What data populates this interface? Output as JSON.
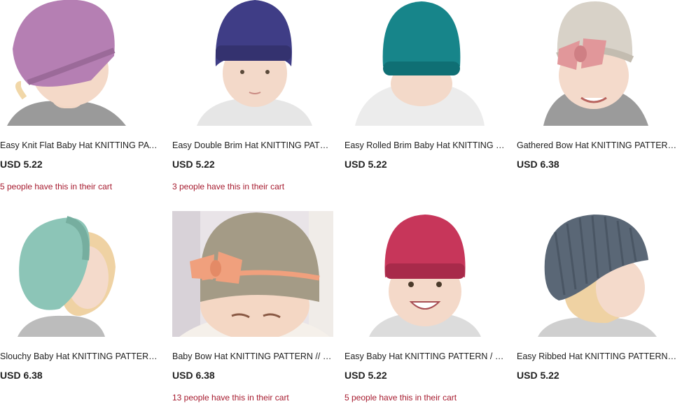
{
  "listings": [
    {
      "title": "Easy Knit Flat Baby Hat KNITTING PATTERN / Knit Baby Hat Pattern",
      "price": "USD 5.22",
      "cart_note": "5 people have this in their cart",
      "hat_color": "#b57fb3",
      "bg": "#ffffff",
      "hair": "#f1d7a8",
      "shirt": "#9a9a9a"
    },
    {
      "title": "Easy Double Brim Hat KNITTING PATTERN / Baby Hat Pattern",
      "price": "USD 5.22",
      "cart_note": "3 people have this in their cart",
      "hat_color": "#3f3d86",
      "bg": "#ffffff",
      "hair": "#d9b48c",
      "shirt": "#e6e6e6"
    },
    {
      "title": "Easy Rolled Brim Baby Hat KNITTING PATTERN / Knit Hat",
      "price": "USD 5.22",
      "cart_note": "",
      "hat_color": "#17858a",
      "bg": "#ffffff",
      "hair": "#e9c6a0",
      "shirt": "#ececec"
    },
    {
      "title": "Gathered Bow Hat KNITTING PATTERN / Baby Hat with Bow",
      "price": "USD 6.38",
      "cart_note": "",
      "hat_color": "#d8d2c8",
      "bg": "#ffffff",
      "hair": "#e6c49b",
      "shirt": "#9b9b9b",
      "bow": "#e1979a"
    },
    {
      "title": "Slouchy Baby Hat KNITTING PATTERN / Knit Slouch Hat",
      "price": "USD 6.38",
      "cart_note": "",
      "hat_color": "#8cc5b7",
      "bg": "#ffffff",
      "hair": "#efd2a3",
      "shirt": "#bcbcbc"
    },
    {
      "title": "Baby Bow Hat KNITTING PATTERN // Knit Hat with Bow",
      "price": "USD 6.38",
      "cart_note": "13 people have this in their cart",
      "hat_color": "#a49b86",
      "bg": "#e9e4e8",
      "hair": "#e9c6a0",
      "shirt": "#f5f0ea",
      "bow": "#f0a07d"
    },
    {
      "title": "Easy Baby Hat KNITTING PATTERN / Easy Knit Hat",
      "price": "USD 5.22",
      "cart_note": "5 people have this in their cart",
      "hat_color": "#c7365a",
      "bg": "#ffffff",
      "hair": "#e9c6a0",
      "shirt": "#dcdcdc"
    },
    {
      "title": "Easy Ribbed Hat KNITTING PATTERN / Ribbed Baby Hat",
      "price": "USD 5.22",
      "cart_note": "",
      "hat_color": "#5a6776",
      "bg": "#ffffff",
      "hair": "#efd2a3",
      "shirt": "#cfcfcf"
    }
  ]
}
